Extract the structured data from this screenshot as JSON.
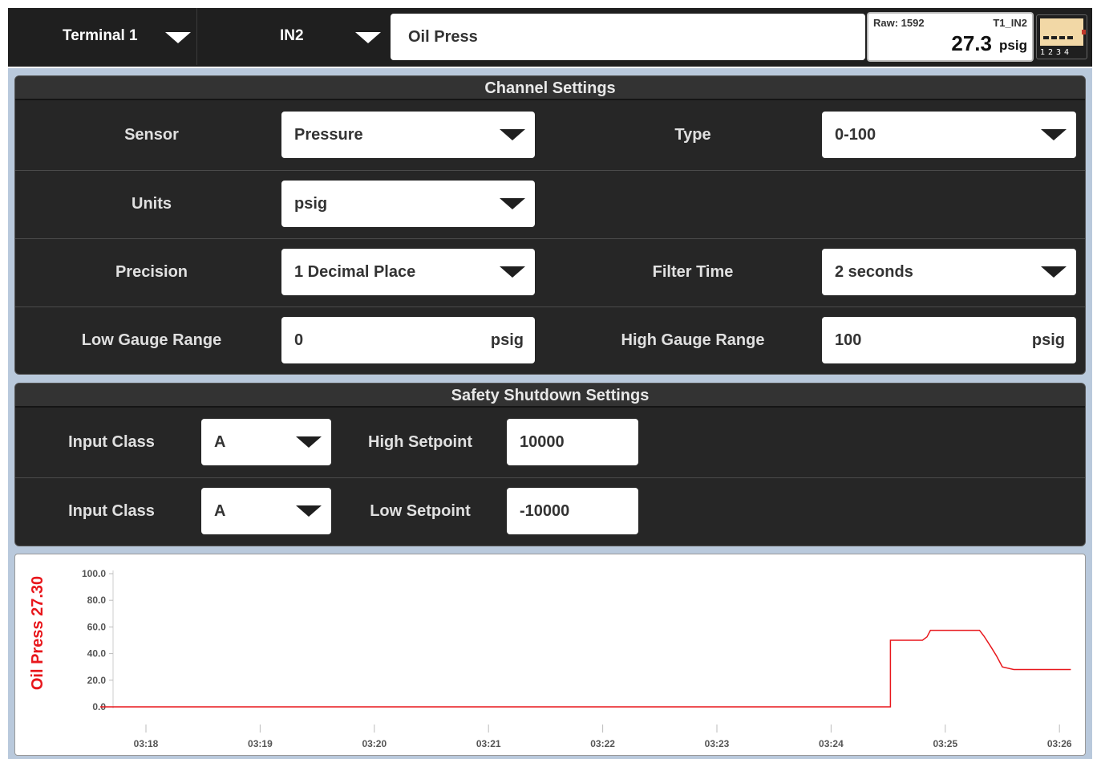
{
  "topbar": {
    "terminal": "Terminal 1",
    "input": "IN2",
    "channel_name": "Oil Press",
    "raw": "Raw: 1592",
    "tag": "T1_IN2",
    "value": "27.3",
    "unit": "psig",
    "layout_numbers": "1234"
  },
  "channel_settings": {
    "title": "Channel Settings",
    "sensor_label": "Sensor",
    "sensor_value": "Pressure",
    "type_label": "Type",
    "type_value": "0-100",
    "units_label": "Units",
    "units_value": "psig",
    "precision_label": "Precision",
    "precision_value": "1 Decimal Place",
    "filter_label": "Filter Time",
    "filter_value": "2 seconds",
    "low_gauge_label": "Low Gauge Range",
    "low_gauge_value": "0",
    "low_gauge_unit": "psig",
    "high_gauge_label": "High Gauge Range",
    "high_gauge_value": "100",
    "high_gauge_unit": "psig"
  },
  "safety": {
    "title": "Safety Shutdown Settings",
    "input_class_label_1": "Input Class",
    "input_class_value_1": "A",
    "high_setpoint_label": "High Setpoint",
    "high_setpoint_value": "10000",
    "input_class_label_2": "Input Class",
    "input_class_value_2": "A",
    "low_setpoint_label": "Low Setpoint",
    "low_setpoint_value": "-10000"
  },
  "colors": {
    "accent_red": "#e8171c",
    "panel_dark": "#262626",
    "panel_bg": "#b9c9dc"
  },
  "chart_data": {
    "type": "line",
    "ylabel": "Oil Press 27.30",
    "ylim": [
      0,
      100
    ],
    "yticks": [
      "0.0",
      "20.0",
      "40.0",
      "60.0",
      "80.0",
      "100.0"
    ],
    "xticks": [
      "03:18",
      "03:19",
      "03:20",
      "03:21",
      "03:22",
      "03:23",
      "03:24",
      "03:25",
      "03:26"
    ],
    "grid": false,
    "series": [
      {
        "x": [
          "03:17.6",
          "03:24.52",
          "03:24.52",
          "03:24.8",
          "03:24.84",
          "03:24.87",
          "03:25.3",
          "03:25.34",
          "03:25.4",
          "03:25.45",
          "03:25.5",
          "03:25.6",
          "03:26.1"
        ],
        "values": [
          0.0,
          0.0,
          50.0,
          50.0,
          52.5,
          57.5,
          57.5,
          53.0,
          45.0,
          38.0,
          30.0,
          28.0,
          28.0
        ],
        "color": "#e8171c"
      }
    ]
  }
}
